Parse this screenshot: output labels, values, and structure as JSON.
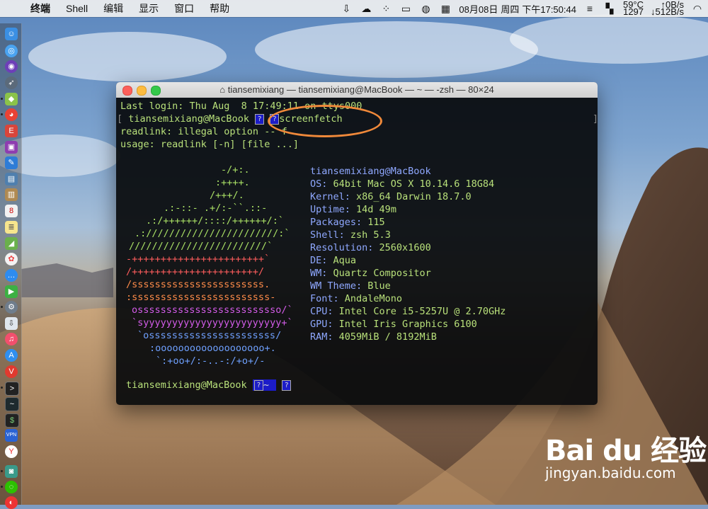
{
  "menubar": {
    "app_name": "终端",
    "items": [
      "Shell",
      "编辑",
      "显示",
      "窗口",
      "帮助"
    ],
    "date": "08月08日",
    "weekday": "周四",
    "time": "下午17:50:44",
    "temp": "59°C",
    "cpu_value": "1297",
    "net_up": "↑0B/s",
    "net_down": "↓512B/s"
  },
  "terminal": {
    "title": "tiansemixiang — tiansemixiang@MacBook — ~ — -zsh — 80×24",
    "last_login": "Last login: Thu Aug  8 17:49:11 on ttys000",
    "prompt_user": "tiansemixiang@MacBook",
    "command": "screenfetch",
    "error1": "readlink: illegal option -- f",
    "error2": "usage: readlink [-n] [file ...]",
    "header": "tiansemixiang@MacBook",
    "info": [
      {
        "label": "OS:",
        "value": "64bit Mac OS X 10.14.6 18G84"
      },
      {
        "label": "Kernel:",
        "value": "x86_64 Darwin 18.7.0"
      },
      {
        "label": "Uptime:",
        "value": "14d 49m"
      },
      {
        "label": "Packages:",
        "value": "115"
      },
      {
        "label": "Shell:",
        "value": "zsh 5.3"
      },
      {
        "label": "Resolution:",
        "value": "2560x1600"
      },
      {
        "label": "DE:",
        "value": "Aqua"
      },
      {
        "label": "WM:",
        "value": "Quartz Compositor"
      },
      {
        "label": "WM Theme:",
        "value": "Blue"
      },
      {
        "label": "Font:",
        "value": "AndaleMono"
      },
      {
        "label": "CPU:",
        "value": "Intel Core i5-5257U @ 2.70GHz"
      },
      {
        "label": "GPU:",
        "value": "Intel Iris Graphics 6100"
      },
      {
        "label": "RAM:",
        "value": "4059MiB / 8192MiB"
      }
    ],
    "art": [
      "-/+:.",
      ":++++.",
      "/+++/.",
      ".:-::- .+/:-``.::-",
      ".:/++++++/::::/++++++/:`",
      ".:///////////////////////:`",
      "////////////////////////`",
      "-+++++++++++++++++++++++`",
      "/++++++++++++++++++++++/",
      "/sssssssssssssssssssssss.",
      ":ssssssssssssssssssssssss-",
      "osssssssssssssssssssssssso/`",
      "`syyyyyyyyyyyyyyyyyyyyyyyy+`",
      "`ossssssssssssssssssssss/",
      ":ooooooooooooooooooo+.",
      "`:+oo+/:-..-:/+o+/-"
    ],
    "final_prompt_user": "tiansemixiang@MacBook",
    "final_prompt_dir": "~"
  },
  "watermark": {
    "brand": "Bai du 经验",
    "url": "jingyan.baidu.com"
  }
}
